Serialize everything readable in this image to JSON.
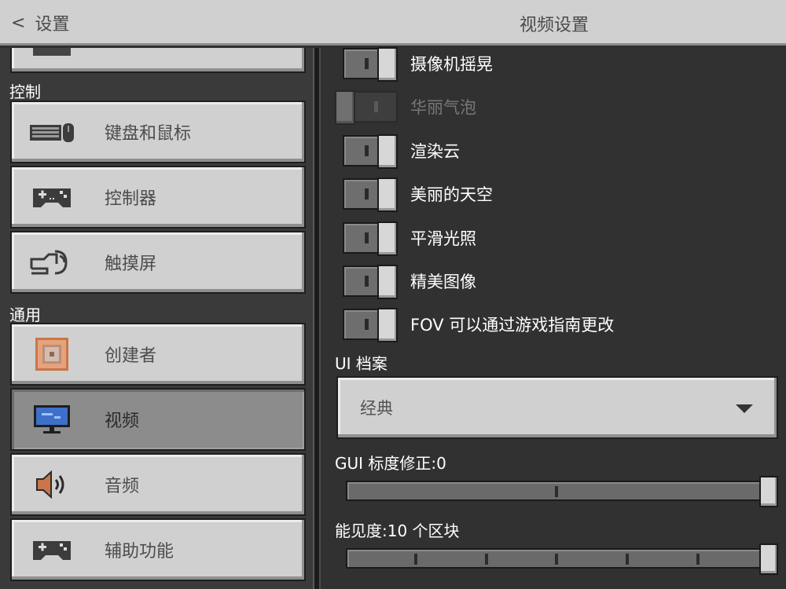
{
  "header": {
    "back_label": "设置",
    "title": "视频设置"
  },
  "sidebar": {
    "sections": [
      {
        "label": "控制"
      },
      {
        "label": "通用"
      }
    ],
    "items": [
      {
        "label": "键盘和鼠标",
        "icon": "keyboard-mouse-icon"
      },
      {
        "label": "控制器",
        "icon": "gamepad-icon"
      },
      {
        "label": "触摸屏",
        "icon": "touch-hand-icon"
      },
      {
        "label": "创建者",
        "icon": "command-block-icon"
      },
      {
        "label": "视频",
        "icon": "monitor-icon",
        "selected": true
      },
      {
        "label": "音频",
        "icon": "speaker-icon"
      },
      {
        "label": "辅助功能",
        "icon": "gamepad-icon"
      }
    ]
  },
  "settings": {
    "toggles": [
      {
        "label": "摄像机摇晃",
        "on": true,
        "enabled": true
      },
      {
        "label": "华丽气泡",
        "on": false,
        "enabled": false
      },
      {
        "label": "渲染云",
        "on": true,
        "enabled": true
      },
      {
        "label": "美丽的天空",
        "on": true,
        "enabled": true
      },
      {
        "label": "平滑光照",
        "on": true,
        "enabled": true
      },
      {
        "label": "精美图像",
        "on": true,
        "enabled": true
      },
      {
        "label": "FOV 可以通过游戏指南更改",
        "on": true,
        "enabled": true
      }
    ],
    "ui_profile": {
      "label": "UI 档案",
      "value": "经典"
    },
    "gui_scale": {
      "label": "GUI 标度修正:0",
      "value": 0,
      "min": -1,
      "max": 0
    },
    "render_distance": {
      "label": "能见度:10 个区块",
      "value": 10,
      "min": 5,
      "max": 10
    }
  },
  "colors": {
    "button_face": "#d0d0d0",
    "selected_face": "#8c8c8c",
    "panel_bg": "#313131"
  }
}
